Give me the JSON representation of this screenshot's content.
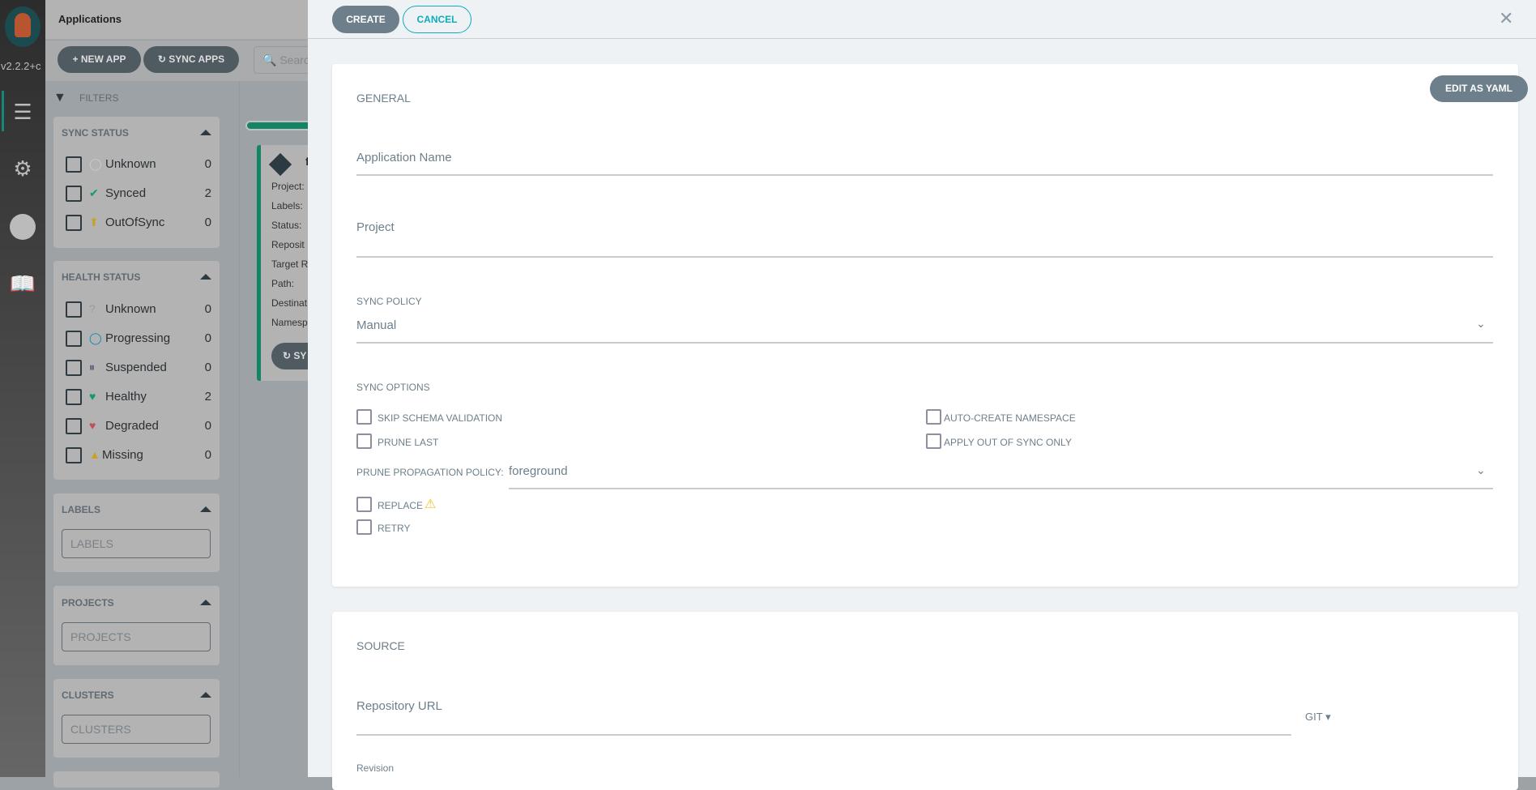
{
  "sidebar": {
    "version": "v2.2.2+c",
    "items": [
      {
        "icon": "layers-icon"
      },
      {
        "icon": "gear-icon"
      },
      {
        "icon": "user-icon"
      },
      {
        "icon": "docs-icon"
      }
    ]
  },
  "header": {
    "title": "Applications"
  },
  "toolbar": {
    "new_app": "NEW APP",
    "sync_apps": "SYNC APPS",
    "search_placeholder": "Search"
  },
  "filters": {
    "title": "FILTERS",
    "sync_status": {
      "title": "SYNC STATUS",
      "items": [
        {
          "label": "Unknown",
          "count": "0"
        },
        {
          "label": "Synced",
          "count": "2"
        },
        {
          "label": "OutOfSync",
          "count": "0"
        }
      ]
    },
    "health_status": {
      "title": "HEALTH STATUS",
      "items": [
        {
          "label": "Unknown",
          "count": "0"
        },
        {
          "label": "Progressing",
          "count": "0"
        },
        {
          "label": "Suspended",
          "count": "0"
        },
        {
          "label": "Healthy",
          "count": "2"
        },
        {
          "label": "Degraded",
          "count": "0"
        },
        {
          "label": "Missing",
          "count": "0"
        }
      ]
    },
    "labels": {
      "title": "LABELS",
      "placeholder": "LABELS"
    },
    "projects": {
      "title": "PROJECTS",
      "placeholder": "PROJECTS"
    },
    "clusters": {
      "title": "CLUSTERS",
      "placeholder": "CLUSTERS"
    }
  },
  "app_card": {
    "name": "f",
    "fields": [
      "Project:",
      "Labels:",
      "Status:",
      "Reposit",
      "Target R",
      "Path:",
      "Destinat",
      "Namesp"
    ],
    "sync_label": "SY"
  },
  "panel": {
    "create": "CREATE",
    "cancel": "CANCEL",
    "general": {
      "title": "GENERAL",
      "edit_yaml": "EDIT AS YAML",
      "app_name_label": "Application Name",
      "project_label": "Project",
      "sync_policy_label": "SYNC POLICY",
      "sync_policy_value": "Manual",
      "sync_options_label": "SYNC OPTIONS",
      "options": {
        "skip_schema": "SKIP SCHEMA VALIDATION",
        "prune_last": "PRUNE LAST",
        "auto_create_ns": "AUTO-CREATE NAMESPACE",
        "apply_oos": "APPLY OUT OF SYNC ONLY",
        "replace": "REPLACE",
        "retry": "RETRY"
      },
      "prune_policy_label": "PRUNE PROPAGATION POLICY:",
      "prune_policy_value": "foreground"
    },
    "source": {
      "title": "SOURCE",
      "repo_url_label": "Repository URL",
      "repo_type": "GIT",
      "revision_label": "Revision"
    }
  },
  "colors": {
    "accent": "#0dadba",
    "button": "#6d7f8b",
    "synced": "#18be94",
    "healthy": "#18be94",
    "degraded": "#e96d76",
    "missing": "#f4c030",
    "outofsync": "#f4c030",
    "progressing": "#0dadea",
    "suspended": "#766f94"
  }
}
